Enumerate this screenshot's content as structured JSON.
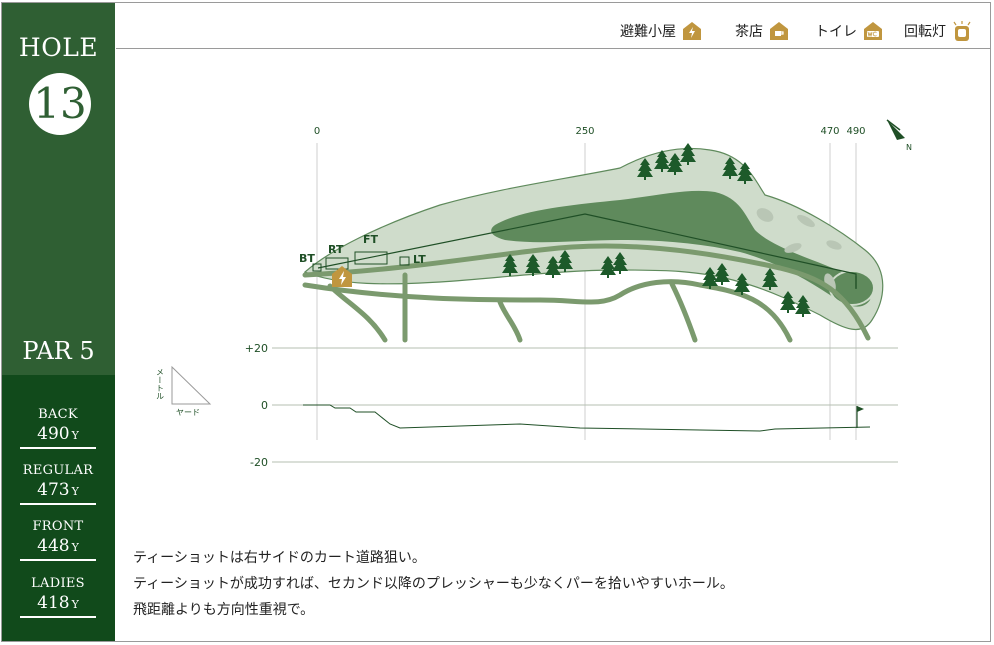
{
  "hole": {
    "label": "HOLE",
    "number": "13",
    "par": "PAR 5"
  },
  "tees": [
    {
      "name": "BACK",
      "yards": "490",
      "unit": "Y"
    },
    {
      "name": "REGULAR",
      "yards": "473",
      "unit": "Y"
    },
    {
      "name": "FRONT",
      "yards": "448",
      "unit": "Y"
    },
    {
      "name": "LADIES",
      "yards": "418",
      "unit": "Y"
    }
  ],
  "legend": [
    {
      "label": "避難小屋",
      "icon": "lightning-hut-icon"
    },
    {
      "label": "茶店",
      "icon": "teahouse-icon"
    },
    {
      "label": "トイレ",
      "icon": "toilet-wc-icon"
    },
    {
      "label": "回転灯",
      "icon": "rotating-light-icon"
    }
  ],
  "map": {
    "distance_marks": [
      "0",
      "250",
      "470",
      "490"
    ],
    "tee_labels": [
      "BT",
      "RT",
      "FT",
      "LT"
    ],
    "compass": "N"
  },
  "elevation": {
    "labels": [
      "+20",
      "0",
      "-20"
    ],
    "key_vertical": "メートル",
    "key_horizontal": "ヤード"
  },
  "description": [
    "ティーショットは右サイドのカート道路狙い。",
    "ティーショットが成功すれば、セカンド以降のプレッシャーも少なくパーを拾いやすいホール。",
    "飛距離よりも方向性重視で。"
  ],
  "colors": {
    "sidebar": "#2f5f33",
    "sidebar_lower": "#114a1b",
    "rough": "#cfdccb",
    "fairway": "#5f8a5c",
    "cart_path": "#7b9a6e",
    "tree": "#1d5a2a",
    "icon_gold": "#c0963f"
  }
}
